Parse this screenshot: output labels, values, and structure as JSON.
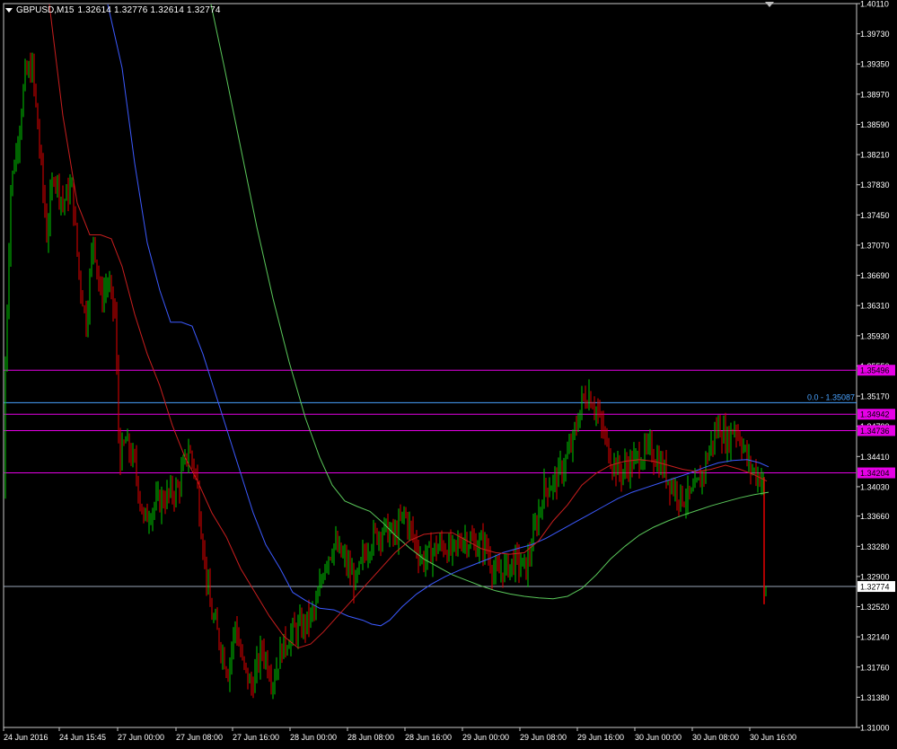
{
  "header": {
    "symbol": "GBPUSD,M15",
    "ohlc": "1.32614 1.32776 1.32614 1.32774"
  },
  "colors": {
    "background": "#000000",
    "grid_frame": "#c8c8c8",
    "text": "#ffffff",
    "bull": "#00c800",
    "bear": "#e60000",
    "ma_red": "#c81e1e",
    "ma_blue": "#3c5aff",
    "ma_green": "#5ac85a",
    "level": "#e600e6",
    "fib": "#4aa3ff",
    "bid": "#9aa6b8"
  },
  "chart_data": {
    "type": "candlestick",
    "ylim": [
      1.31,
      1.4011
    ],
    "price_ticks": [
      "1.40110",
      "1.39730",
      "1.39350",
      "1.38970",
      "1.38590",
      "1.38210",
      "1.37830",
      "1.37450",
      "1.37070",
      "1.36690",
      "1.36310",
      "1.35930",
      "1.35550",
      "1.35170",
      "1.34790",
      "1.34410",
      "1.34030",
      "1.33660",
      "1.33280",
      "1.32900",
      "1.32520",
      "1.32140",
      "1.31760",
      "1.31380",
      "1.31000"
    ],
    "time_labels": [
      "24 Jun 2016",
      "24 Jun 15:45",
      "27 Jun 00:00",
      "27 Jun 08:00",
      "27 Jun 16:00",
      "28 Jun 00:00",
      "28 Jun 08:00",
      "28 Jun 16:00",
      "29 Jun 00:00",
      "29 Jun 08:00",
      "29 Jun 16:00",
      "30 Jun 00:00",
      "30 Jun 08:00",
      "30 Jun 16:00"
    ],
    "levels": [
      {
        "label": "1.35496",
        "value": 1.35496
      },
      {
        "label": "1.34942",
        "value": 1.34942
      },
      {
        "label": "1.34736",
        "value": 1.34736
      },
      {
        "label": "1.34204",
        "value": 1.34204
      }
    ],
    "fib": {
      "label": "0.0 - 1.35087",
      "value": 1.35087
    },
    "bid": {
      "label": "1.32774",
      "value": 1.32774
    },
    "price_path": [
      [
        0,
        1.339
      ],
      [
        5,
        1.352
      ],
      [
        12,
        1.378
      ],
      [
        20,
        1.384
      ],
      [
        28,
        1.392
      ],
      [
        36,
        1.393
      ],
      [
        44,
        1.383
      ],
      [
        52,
        1.372
      ],
      [
        60,
        1.38
      ],
      [
        70,
        1.376
      ],
      [
        80,
        1.378
      ],
      [
        88,
        1.367
      ],
      [
        96,
        1.361
      ],
      [
        104,
        1.372
      ],
      [
        112,
        1.364
      ],
      [
        120,
        1.366
      ],
      [
        128,
        1.362
      ],
      [
        133,
        1.3435
      ],
      [
        140,
        1.346
      ],
      [
        150,
        1.343
      ],
      [
        160,
        1.336
      ],
      [
        172,
        1.338
      ],
      [
        185,
        1.339
      ],
      [
        198,
        1.34
      ],
      [
        210,
        1.345
      ],
      [
        218,
        1.342
      ],
      [
        226,
        1.333
      ],
      [
        234,
        1.325
      ],
      [
        244,
        1.321
      ],
      [
        254,
        1.317
      ],
      [
        262,
        1.323
      ],
      [
        270,
        1.318
      ],
      [
        280,
        1.315
      ],
      [
        292,
        1.32
      ],
      [
        304,
        1.316
      ],
      [
        314,
        1.32
      ],
      [
        326,
        1.322
      ],
      [
        340,
        1.323
      ],
      [
        352,
        1.325
      ],
      [
        362,
        1.331
      ],
      [
        372,
        1.333
      ],
      [
        384,
        1.331
      ],
      [
        396,
        1.328
      ],
      [
        406,
        1.332
      ],
      [
        416,
        1.334
      ],
      [
        428,
        1.335
      ],
      [
        440,
        1.334
      ],
      [
        450,
        1.337
      ],
      [
        460,
        1.334
      ],
      [
        470,
        1.331
      ],
      [
        480,
        1.332
      ],
      [
        492,
        1.333
      ],
      [
        504,
        1.332
      ],
      [
        516,
        1.334
      ],
      [
        528,
        1.333
      ],
      [
        540,
        1.333
      ],
      [
        552,
        1.329
      ],
      [
        562,
        1.33
      ],
      [
        574,
        1.331
      ],
      [
        586,
        1.33
      ],
      [
        596,
        1.335
      ],
      [
        606,
        1.34
      ],
      [
        618,
        1.341
      ],
      [
        628,
        1.343
      ],
      [
        638,
        1.346
      ],
      [
        648,
        1.351
      ],
      [
        656,
        1.352
      ],
      [
        664,
        1.35
      ],
      [
        672,
        1.347
      ],
      [
        680,
        1.344
      ],
      [
        690,
        1.342
      ],
      [
        700,
        1.343
      ],
      [
        712,
        1.344
      ],
      [
        724,
        1.345
      ],
      [
        736,
        1.343
      ],
      [
        746,
        1.341
      ],
      [
        758,
        1.339
      ],
      [
        770,
        1.339
      ],
      [
        780,
        1.341
      ],
      [
        790,
        1.345
      ],
      [
        800,
        1.348
      ],
      [
        810,
        1.346
      ],
      [
        818,
        1.348
      ],
      [
        826,
        1.346
      ],
      [
        834,
        1.343
      ],
      [
        842,
        1.342
      ],
      [
        850,
        1.341
      ]
    ],
    "final_drop": {
      "from": 1.3415,
      "low": 1.3255,
      "close": 1.32774
    },
    "ma_red": [
      [
        55,
        1.401
      ],
      [
        70,
        1.387
      ],
      [
        86,
        1.376
      ],
      [
        100,
        1.372
      ],
      [
        112,
        1.372
      ],
      [
        124,
        1.3715
      ],
      [
        136,
        1.368
      ],
      [
        150,
        1.362
      ],
      [
        164,
        1.357
      ],
      [
        178,
        1.353
      ],
      [
        192,
        1.348
      ],
      [
        206,
        1.344
      ],
      [
        220,
        1.341
      ],
      [
        236,
        1.337
      ],
      [
        252,
        1.334
      ],
      [
        268,
        1.33
      ],
      [
        284,
        1.327
      ],
      [
        300,
        1.324
      ],
      [
        316,
        1.3215
      ],
      [
        332,
        1.32
      ],
      [
        346,
        1.3205
      ],
      [
        360,
        1.322
      ],
      [
        376,
        1.324
      ],
      [
        392,
        1.326
      ],
      [
        408,
        1.328
      ],
      [
        424,
        1.33
      ],
      [
        440,
        1.332
      ],
      [
        456,
        1.3335
      ],
      [
        472,
        1.3343
      ],
      [
        488,
        1.3345
      ],
      [
        504,
        1.3345
      ],
      [
        520,
        1.3335
      ],
      [
        536,
        1.3325
      ],
      [
        552,
        1.332
      ],
      [
        568,
        1.3318
      ],
      [
        584,
        1.332
      ],
      [
        600,
        1.3335
      ],
      [
        616,
        1.336
      ],
      [
        632,
        1.338
      ],
      [
        648,
        1.3405
      ],
      [
        664,
        1.342
      ],
      [
        680,
        1.343
      ],
      [
        696,
        1.3435
      ],
      [
        712,
        1.3437
      ],
      [
        728,
        1.3435
      ],
      [
        744,
        1.343
      ],
      [
        760,
        1.3425
      ],
      [
        776,
        1.3422
      ],
      [
        792,
        1.3425
      ],
      [
        808,
        1.343
      ],
      [
        824,
        1.3425
      ],
      [
        840,
        1.3418
      ],
      [
        854,
        1.341
      ]
    ],
    "ma_blue": [
      [
        120,
        1.401
      ],
      [
        136,
        1.393
      ],
      [
        150,
        1.381
      ],
      [
        164,
        1.371
      ],
      [
        178,
        1.365
      ],
      [
        190,
        1.361
      ],
      [
        202,
        1.361
      ],
      [
        214,
        1.3605
      ],
      [
        226,
        1.357
      ],
      [
        240,
        1.352
      ],
      [
        254,
        1.347
      ],
      [
        268,
        1.342
      ],
      [
        282,
        1.337
      ],
      [
        296,
        1.333
      ],
      [
        312,
        1.33
      ],
      [
        326,
        1.327
      ],
      [
        340,
        1.326
      ],
      [
        356,
        1.325
      ],
      [
        372,
        1.3248
      ],
      [
        388,
        1.324
      ],
      [
        404,
        1.3235
      ],
      [
        414,
        1.323
      ],
      [
        424,
        1.3228
      ],
      [
        434,
        1.3235
      ],
      [
        448,
        1.3252
      ],
      [
        464,
        1.3268
      ],
      [
        480,
        1.328
      ],
      [
        496,
        1.329
      ],
      [
        512,
        1.3298
      ],
      [
        528,
        1.3305
      ],
      [
        544,
        1.3312
      ],
      [
        560,
        1.332
      ],
      [
        576,
        1.3325
      ],
      [
        592,
        1.333
      ],
      [
        608,
        1.3338
      ],
      [
        624,
        1.3348
      ],
      [
        640,
        1.3358
      ],
      [
        656,
        1.3368
      ],
      [
        672,
        1.3378
      ],
      [
        688,
        1.3388
      ],
      [
        704,
        1.3396
      ],
      [
        720,
        1.3402
      ],
      [
        736,
        1.3408
      ],
      [
        752,
        1.3414
      ],
      [
        768,
        1.342
      ],
      [
        784,
        1.3427
      ],
      [
        800,
        1.3433
      ],
      [
        816,
        1.3436
      ],
      [
        832,
        1.3437
      ],
      [
        846,
        1.3433
      ],
      [
        856,
        1.3428
      ]
    ],
    "ma_green": [
      [
        235,
        1.401
      ],
      [
        250,
        1.393
      ],
      [
        268,
        1.383
      ],
      [
        286,
        1.373
      ],
      [
        304,
        1.364
      ],
      [
        322,
        1.356
      ],
      [
        340,
        1.349
      ],
      [
        356,
        1.344
      ],
      [
        370,
        1.3405
      ],
      [
        384,
        1.3385
      ],
      [
        398,
        1.3378
      ],
      [
        412,
        1.3372
      ],
      [
        426,
        1.3358
      ],
      [
        440,
        1.3342
      ],
      [
        456,
        1.3326
      ],
      [
        472,
        1.3312
      ],
      [
        488,
        1.3302
      ],
      [
        504,
        1.3292
      ],
      [
        520,
        1.3285
      ],
      [
        536,
        1.3278
      ],
      [
        552,
        1.3272
      ],
      [
        568,
        1.3268
      ],
      [
        584,
        1.3265
      ],
      [
        600,
        1.3263
      ],
      [
        616,
        1.3262
      ],
      [
        632,
        1.3265
      ],
      [
        648,
        1.3275
      ],
      [
        664,
        1.3292
      ],
      [
        680,
        1.3312
      ],
      [
        696,
        1.3328
      ],
      [
        712,
        1.3342
      ],
      [
        728,
        1.3352
      ],
      [
        744,
        1.336
      ],
      [
        760,
        1.3367
      ],
      [
        776,
        1.3373
      ],
      [
        792,
        1.3379
      ],
      [
        808,
        1.3384
      ],
      [
        824,
        1.3389
      ],
      [
        840,
        1.3393
      ],
      [
        856,
        1.3396
      ]
    ]
  }
}
